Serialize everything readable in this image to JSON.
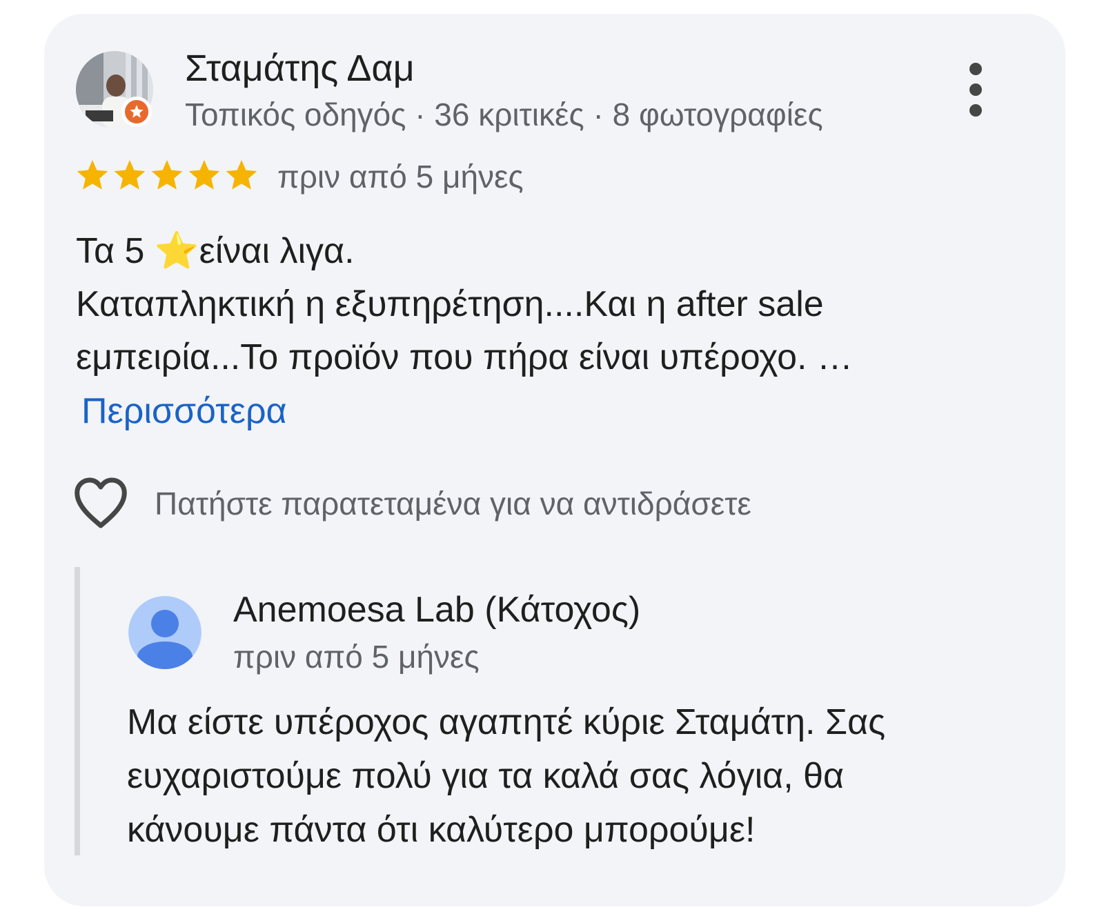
{
  "review": {
    "reviewer_name": "Σταμάτης Δαμ",
    "reviewer_meta": "Τοπικός οδηγός · 36 κριτικές · 8 φωτογραφίες",
    "rating_stars": 5,
    "rating_max": 5,
    "date": "πριν από 5 μήνες",
    "text_line_1": "Τα 5 ⭐είναι λιγα.",
    "text_line_2": "Καταπληκτική η εξυπηρέτηση....Και η after sale",
    "text_line_3": "εμπειρία...Το προϊόν που πήρα είναι υπέροχο. …",
    "more_link": "Περισσότερα",
    "react_hint": "Πατήστε παρατεταμένα για να αντιδράσετε"
  },
  "owner_reply": {
    "name": "Anemoesa Lab (Κάτοχος)",
    "date": "πριν από 5 μήνες",
    "text_line_1": "Μα είστε υπέροχος αγαπητέ κύριε Σταμάτη. Σας",
    "text_line_2": "ευχαριστούμε πολύ για τα καλά σας λόγια, θα",
    "text_line_3": "κάνουμε πάντα ότι καλύτερο μπορούμε!"
  },
  "icons": {
    "more": "more-vert-icon",
    "star": "star-icon",
    "heart": "heart-outline-icon",
    "guide_badge": "local-guide-badge-icon",
    "owner_avatar": "default-profile-icon"
  },
  "colors": {
    "card_background": "#f3f4f7",
    "star": "#f6b400",
    "link": "#1a63c7",
    "local_guide_badge": "#e8692c",
    "owner_avatar": "#4b80e6",
    "owner_avatar_background": "#aecbfa"
  }
}
